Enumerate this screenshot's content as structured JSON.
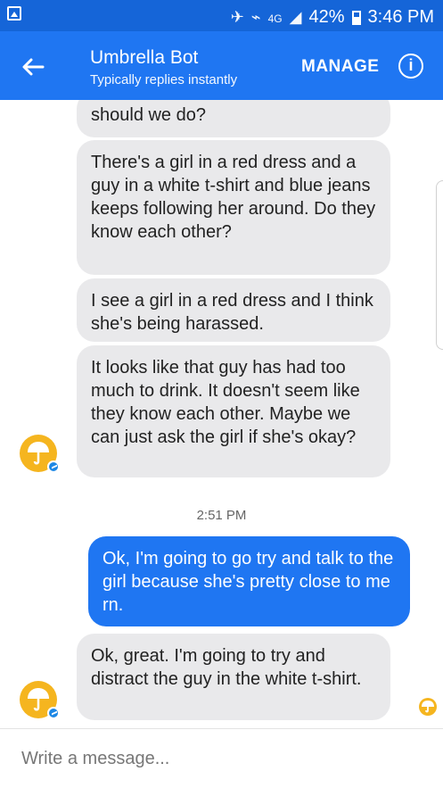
{
  "status_bar": {
    "battery": "42%",
    "time": "3:46 PM",
    "network": "4G"
  },
  "header": {
    "title": "Umbrella Bot",
    "subtitle": "Typically replies instantly",
    "manage_label": "MANAGE",
    "info_icon": "info-icon",
    "back_icon": "arrow-left-icon"
  },
  "messages": [
    {
      "from": "bot",
      "text": "should we do?"
    },
    {
      "from": "bot",
      "text": "There's a girl in a red dress and a guy in a white t-shirt and blue jeans keeps following her around. Do they know each other?"
    },
    {
      "from": "bot",
      "text": "I see a girl in a red dress and I think she's being harassed."
    },
    {
      "from": "bot",
      "text": "It looks like that guy has had too much to drink. It doesn't seem like they know each other. Maybe we can just ask the girl if she's okay?"
    },
    {
      "from": "user",
      "text": "Ok, I'm going to go try and talk to the girl because she's pretty close to me rn."
    },
    {
      "from": "bot",
      "text": "Ok, great. I'm going to try and distract the guy in the white t-shirt."
    }
  ],
  "timestamp": "2:51 PM",
  "composer": {
    "placeholder": "Write a message..."
  },
  "colors": {
    "header": "#1f76f2",
    "status_bar": "#1565d8",
    "bot_bubble": "#e9e9eb",
    "user_bubble": "#1f76f2",
    "avatar": "#f5b51f"
  }
}
